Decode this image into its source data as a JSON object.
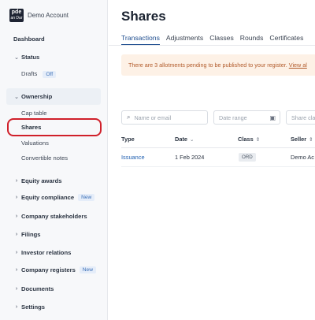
{
  "sidebar": {
    "account_name": "Demo Account",
    "logo_text_top": "pde",
    "logo_text_bottom": "an Dar",
    "dashboard": "Dashboard",
    "status": {
      "label": "Status",
      "drafts": "Drafts",
      "drafts_badge": "Off"
    },
    "ownership": {
      "label": "Ownership",
      "items": [
        "Cap table",
        "Shares",
        "Valuations",
        "Convertible notes"
      ]
    },
    "equity_awards": "Equity awards",
    "equity_compliance": {
      "label": "Equity compliance",
      "badge": "New"
    },
    "company_stakeholders": "Company stakeholders",
    "filings": "Filings",
    "investor_relations": "Investor relations",
    "company_registers": {
      "label": "Company registers",
      "badge": "New"
    },
    "documents": "Documents",
    "settings": "Settings"
  },
  "main": {
    "title": "Shares",
    "tabs": [
      "Transactions",
      "Adjustments",
      "Classes",
      "Rounds",
      "Certificates"
    ],
    "alert": {
      "text": "There are 3 allotments pending to be published to your register.",
      "link": "View al"
    },
    "filters": {
      "search_placeholder": "Name or email",
      "date_placeholder": "Date range",
      "class_placeholder": "Share cla"
    },
    "table": {
      "columns": [
        "Type",
        "Date",
        "Class",
        "Seller"
      ],
      "rows": [
        {
          "type": "Issuance",
          "date": "1 Feb 2024",
          "class": "ORD",
          "seller": "Demo Ac"
        }
      ]
    }
  },
  "colors": {
    "accent": "#1f4e8f",
    "alert_bg": "#fdf1e6",
    "alert_text": "#b15a2a",
    "highlight": "#d0202a"
  }
}
